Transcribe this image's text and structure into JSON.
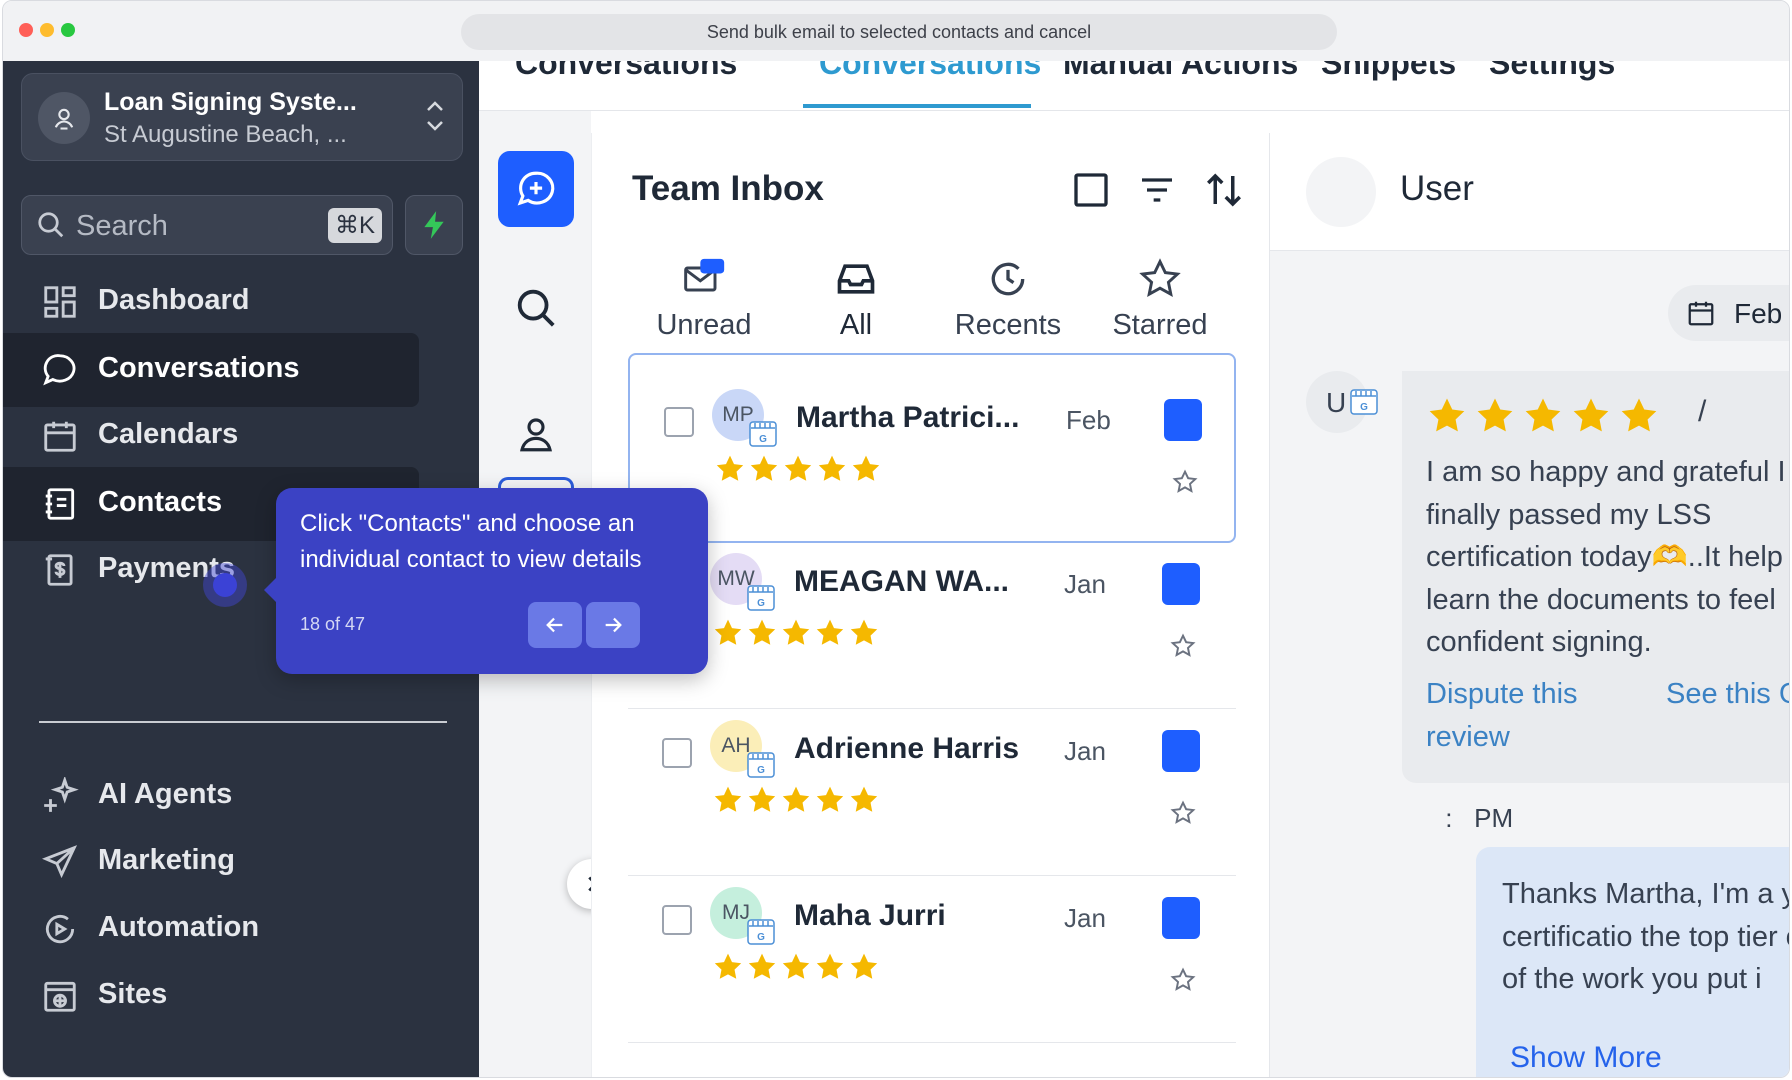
{
  "browser": {
    "url_bar_text": "Send bulk email to selected contacts and cancel"
  },
  "colors": {
    "sidebar_bg": "#2b3240",
    "accent_blue": "#1e5eff",
    "tour_bg": "#3b42c4",
    "star": "#f5b800",
    "link": "#3b82c4"
  },
  "sidebar": {
    "account": {
      "name": "Loan Signing Syste...",
      "location": "St Augustine Beach, ..."
    },
    "search": {
      "placeholder": "Search",
      "shortcut": "⌘K"
    },
    "nav": [
      {
        "label": "Dashboard",
        "icon": "dashboard-icon"
      },
      {
        "label": "Conversations",
        "icon": "chat-bubble-icon",
        "active": true
      },
      {
        "label": "Calendars",
        "icon": "calendar-icon"
      },
      {
        "label": "Contacts",
        "icon": "contacts-icon"
      },
      {
        "label": "Payments",
        "icon": "payments-icon"
      }
    ],
    "nav2": [
      {
        "label": "AI Agents",
        "icon": "sparkles-icon"
      },
      {
        "label": "Marketing",
        "icon": "send-icon"
      },
      {
        "label": "Automation",
        "icon": "automation-icon"
      },
      {
        "label": "Sites",
        "icon": "sites-icon"
      }
    ]
  },
  "topnav": {
    "items": [
      "Conversations",
      "Conversations",
      "Manual Actions",
      "Snippets",
      "Settings"
    ],
    "active_index": 1
  },
  "inbox": {
    "title": "Team Inbox",
    "tabs": [
      {
        "label": "Unread",
        "icon": "mail-icon"
      },
      {
        "label": "All",
        "icon": "inbox-icon",
        "active": true
      },
      {
        "label": "Recents",
        "icon": "clock-icon"
      },
      {
        "label": "Starred",
        "icon": "star-outline-icon"
      }
    ],
    "conversations": [
      {
        "initials": "MP",
        "name": "Martha Patrici...",
        "date": "Feb",
        "rating": 5,
        "avatar_color": "#c9d7f7",
        "selected": true
      },
      {
        "initials": "MW",
        "name": "MEAGAN WA...",
        "date": "Jan",
        "rating": 5,
        "avatar_color": "#e4dcf5"
      },
      {
        "initials": "AH",
        "name": "Adrienne Harris",
        "date": "Jan",
        "rating": 5,
        "avatar_color": "#fbeeb8"
      },
      {
        "initials": "MJ",
        "name": "Maha Jurri",
        "date": "Jan",
        "rating": 5,
        "avatar_color": "#c5efdd"
      }
    ]
  },
  "chat": {
    "header_name": "User",
    "date_pill": "Feb",
    "avatar_letter": "U",
    "review": {
      "rating": 5,
      "slash": "/",
      "text": "I am so happy and grateful I finally passed my LSS certification today🫶..It help me learn the documents to feel confident signing.",
      "link_dispute": "Dispute this review",
      "link_see": "See this GBP"
    },
    "time": " :   PM",
    "reply_text": "Thanks Martha, I'm a your LSS certificatio the top tier of signin of the work you put i",
    "show_more": "Show More"
  },
  "tour": {
    "text": "Click \"Contacts\" and choose an individual contact to view details",
    "progress": "18 of 47",
    "step": 18,
    "total": 47
  }
}
